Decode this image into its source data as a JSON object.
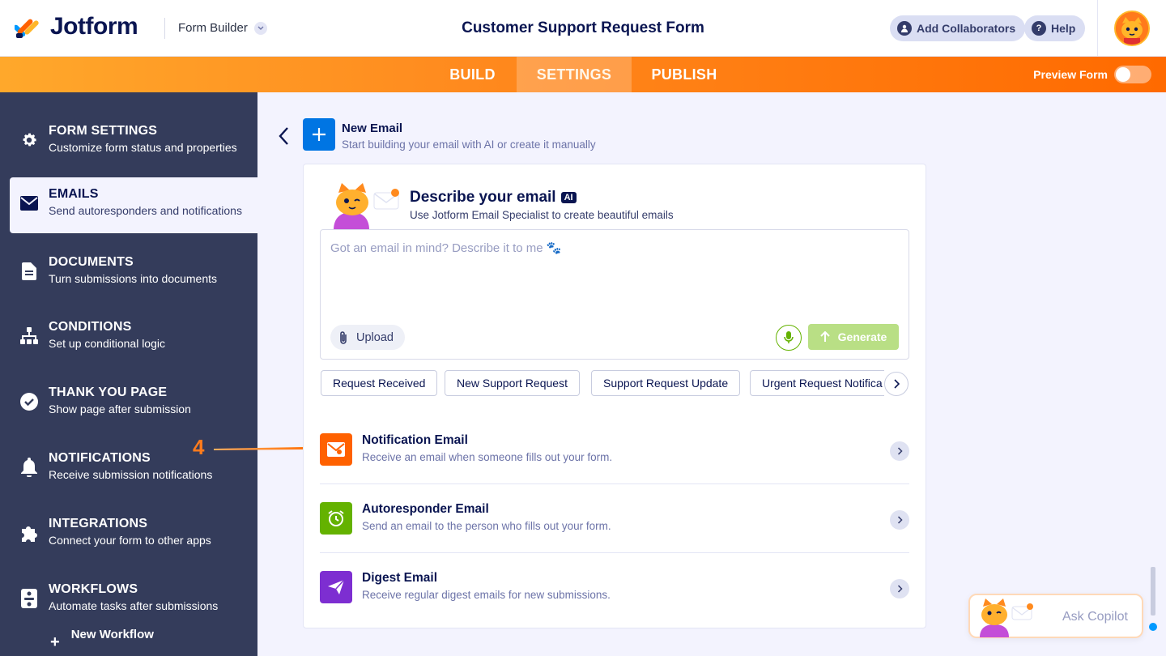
{
  "header": {
    "logo_text": "Jotform",
    "builder_label": "Form Builder",
    "form_title": "Customer Support Request Form",
    "add_collaborators": "Add Collaborators",
    "help": "Help"
  },
  "tabs": {
    "build": "BUILD",
    "settings": "SETTINGS",
    "publish": "PUBLISH",
    "active": "SETTINGS",
    "preview_label": "Preview Form",
    "preview_on": false
  },
  "sidebar": {
    "items": [
      {
        "title": "FORM SETTINGS",
        "sub": "Customize form status and properties",
        "icon": "gear-icon"
      },
      {
        "title": "EMAILS",
        "sub": "Send autoresponders and notifications",
        "icon": "envelope-icon"
      },
      {
        "title": "DOCUMENTS",
        "sub": "Turn submissions into documents",
        "icon": "document-icon"
      },
      {
        "title": "CONDITIONS",
        "sub": "Set up conditional logic",
        "icon": "sitemap-icon"
      },
      {
        "title": "THANK YOU PAGE",
        "sub": "Show page after submission",
        "icon": "check-circle-icon"
      },
      {
        "title": "NOTIFICATIONS",
        "sub": "Receive submission notifications",
        "icon": "bell-icon"
      },
      {
        "title": "INTEGRATIONS",
        "sub": "Connect your form to other apps",
        "icon": "puzzle-icon"
      },
      {
        "title": "WORKFLOWS",
        "sub": "Automate tasks after submissions",
        "icon": "workflow-icon"
      }
    ],
    "active_index": 1,
    "new_workflow": "New Workflow"
  },
  "new_email": {
    "title": "New Email",
    "subtitle": "Start building your email with AI or create it manually"
  },
  "describe": {
    "title": "Describe your email",
    "ai_badge": "AI",
    "subtitle": "Use Jotform Email Specialist to create beautiful emails",
    "placeholder": "Got an email in mind? Describe it to me 🐾",
    "upload": "Upload",
    "generate": "Generate"
  },
  "chips": [
    "Request Received",
    "New Support Request",
    "Support Request Update",
    "Urgent Request Notifica"
  ],
  "options": [
    {
      "title": "Notification Email",
      "sub": "Receive an email when someone fills out your form.",
      "color": "#ff6100",
      "icon": "mail-icon"
    },
    {
      "title": "Autoresponder Email",
      "sub": "Send an email to the person who fills out your form.",
      "color": "#64b200",
      "icon": "alarm-clock-icon"
    },
    {
      "title": "Digest Email",
      "sub": "Receive regular digest emails for new submissions.",
      "color": "#7d2ed1",
      "icon": "paper-plane-icon"
    }
  ],
  "annotation": {
    "step": "4"
  },
  "copilot": {
    "label": "Ask Copilot"
  },
  "colors": {
    "accent_orange": "#ff6100",
    "sidebar_bg": "#343c5b",
    "primary_blue": "#0075e3",
    "navy": "#0a1551"
  }
}
